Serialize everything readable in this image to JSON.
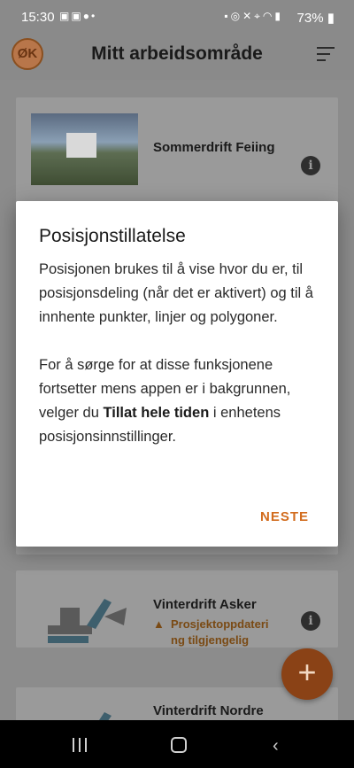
{
  "status_bar": {
    "time": "15:30",
    "left_icons": [
      "notification-icon",
      "notification-icon",
      "chat-icon",
      "dot-icon"
    ],
    "right_icons": [
      "lock-icon",
      "alarm-icon",
      "mute-icon",
      "location-icon",
      "wifi-icon",
      "signal-icon"
    ],
    "battery": "73%"
  },
  "app_bar": {
    "logo": "ØK",
    "title": "Mitt arbeidsområde"
  },
  "cards": [
    {
      "title": "Sommerdrift Feiing"
    },
    {
      "title": "Vinterdrift Asker",
      "update_line1": "Prosjektoppdateri",
      "update_line2": "ng tilgjengelig"
    },
    {
      "title": "Vinterdrift Nordre"
    }
  ],
  "dialog": {
    "title": "Posisjonstillatelse",
    "paragraph1": "Posisjonen brukes til å vise hvor du er, til posisjonsdeling (når det er aktivert) og til å innhente punkter, linjer og polygoner.",
    "paragraph2_before": "For å sørge for at disse funksjonene fortsetter mens appen er i bakgrunnen, velger du ",
    "paragraph2_bold": "Tillat hele tiden",
    "paragraph2_after": " i enhetens posisjonsinnstillinger.",
    "button": "NESTE"
  },
  "fab": {
    "label": "+"
  },
  "colors": {
    "accent": "#d26c1e",
    "fab": "#c4601d",
    "warning": "#c77a1f",
    "scrim": "#8a8a8a"
  }
}
